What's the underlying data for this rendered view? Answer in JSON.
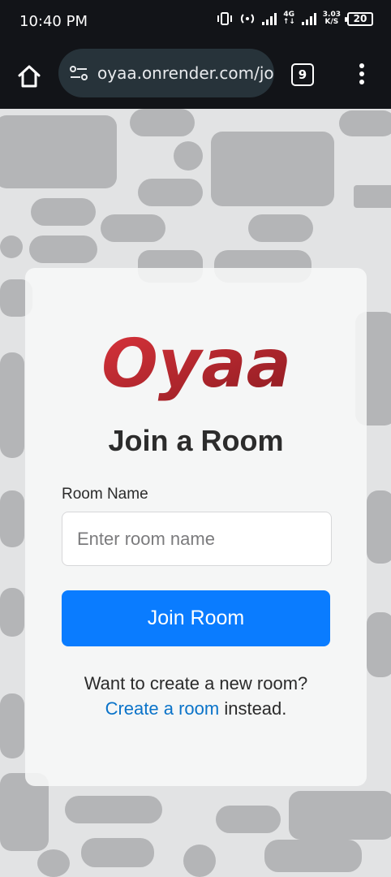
{
  "status_bar": {
    "time": "10:40 PM",
    "network": "4G",
    "speed_value": "3.03",
    "speed_unit": "K/S",
    "battery": "20"
  },
  "browser": {
    "url": "oyaa.onrender.com/joi",
    "tab_count": "9"
  },
  "page": {
    "logo_text": "Oyaa",
    "title": "Join a Room",
    "room_name_label": "Room Name",
    "room_name_placeholder": "Enter room name",
    "room_name_value": "",
    "join_button": "Join Room",
    "create_prompt": "Want to create a new room?",
    "create_link": "Create a room",
    "create_suffix": " instead."
  },
  "colors": {
    "accent": "#0a7cff",
    "link": "#0a73c9",
    "logo_red": "#c5282f",
    "browser_chrome": "#121418"
  }
}
